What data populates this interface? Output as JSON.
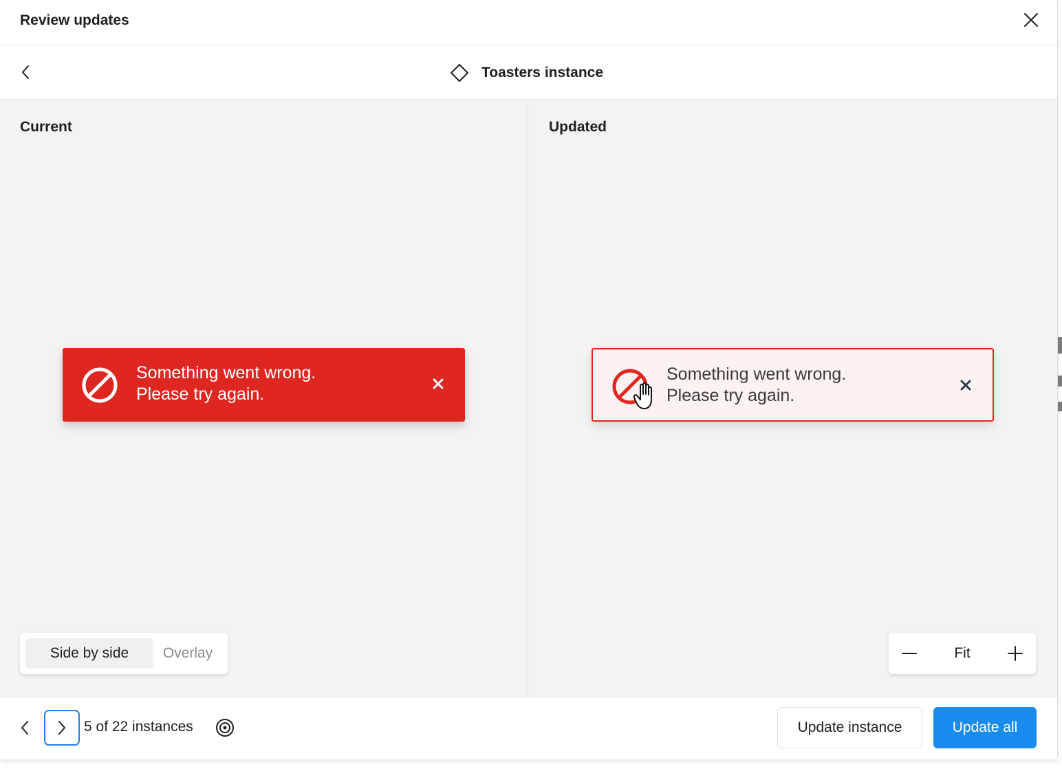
{
  "dialog": {
    "title": "Review updates"
  },
  "subheader": {
    "instance_name": "Toasters instance"
  },
  "panes": {
    "current_label": "Current",
    "updated_label": "Updated"
  },
  "toast_current": {
    "line1": "Something went wrong.",
    "line2": "Please try again."
  },
  "toast_updated": {
    "line1": "Something went wrong.",
    "line2": "Please try again."
  },
  "view_toggle": {
    "side_by_side": "Side by side",
    "overlay": "Overlay",
    "selected": "Side by side"
  },
  "zoom": {
    "fit_label": "Fit"
  },
  "footer": {
    "count_text": "5 of 22 instances",
    "update_instance": "Update instance",
    "update_all": "Update all"
  },
  "colors": {
    "error_red": "#df2721",
    "updated_bg": "#fdf2f2",
    "primary_blue": "#1a8cf0",
    "focus_blue": "#1f7fe6",
    "canvas_bg": "#f3f3f3"
  },
  "icons": [
    "close-icon",
    "chevron-left-icon",
    "component-diamond-icon",
    "prohibited-icon",
    "x-icon",
    "hand-cursor-icon",
    "minus-icon",
    "plus-icon",
    "chevron-right-icon",
    "target-icon"
  ]
}
